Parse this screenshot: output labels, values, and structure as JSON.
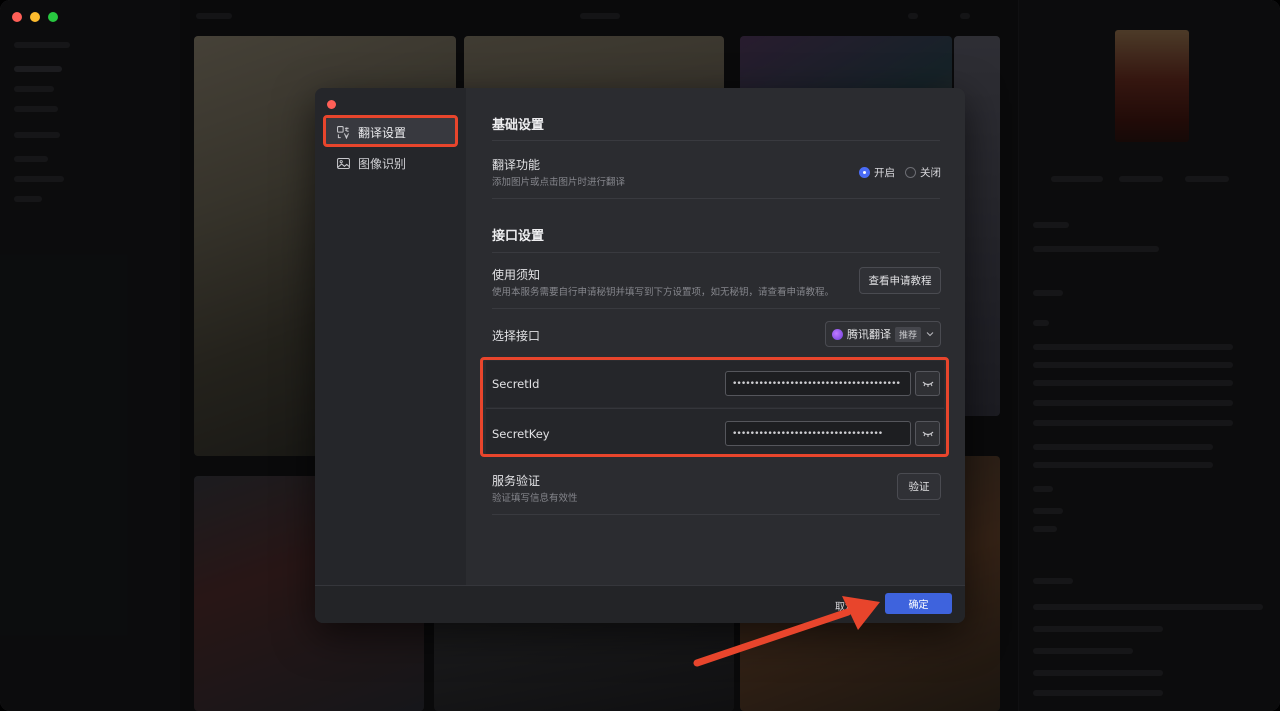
{
  "dialog": {
    "nav": [
      {
        "label": "翻译设置",
        "icon": "translate-icon"
      },
      {
        "label": "图像识别",
        "icon": "image-recognition-icon"
      }
    ],
    "basic_section": {
      "title": "基础设置",
      "translate_feature": {
        "label": "翻译功能",
        "desc": "添加图片或点击图片时进行翻译",
        "options": [
          "开启",
          "关闭"
        ],
        "selected": "开启"
      }
    },
    "api_section": {
      "title": "接口设置",
      "usage_notice": {
        "label": "使用须知",
        "desc": "使用本服务需要自行申请秘钥并填写到下方设置项，如无秘钥，请查看申请教程。",
        "button": "查看申请教程"
      },
      "select_api": {
        "label": "选择接口",
        "value": "腾讯翻译",
        "tag": "推荐"
      },
      "secret_id": {
        "label": "SecretId",
        "value": "••••••••••••••••••••••••••••••••••••••"
      },
      "secret_key": {
        "label": "SecretKey",
        "value": "••••••••••••••••••••••••••••••••••"
      },
      "service_verify": {
        "label": "服务验证",
        "desc": "验证填写信息有效性",
        "button": "验证"
      }
    },
    "footer": {
      "cancel": "取消",
      "confirm": "确定"
    }
  },
  "colors": {
    "accent": "#3e63dd",
    "highlight": "#e8452c",
    "radio_on": "#4a6cf7"
  }
}
